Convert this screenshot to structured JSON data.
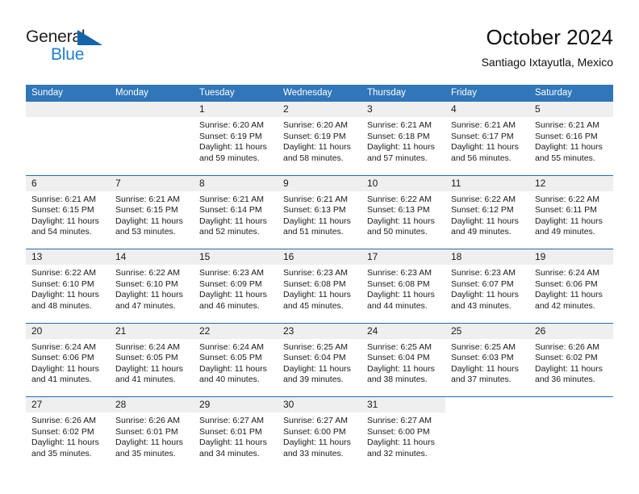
{
  "brand": {
    "name_top": "General",
    "name_bottom": "Blue",
    "color_dark": "#231f20",
    "color_blue": "#1f7fd0",
    "triangle_color": "#1464aa"
  },
  "header": {
    "title": "October 2024",
    "subtitle": "Santiago Ixtayutla, Mexico"
  },
  "theme": {
    "header_bg": "#3076b8",
    "week_rule": "#1f6db5",
    "day_strip_bg": "#efefef"
  },
  "weekdays": [
    "Sunday",
    "Monday",
    "Tuesday",
    "Wednesday",
    "Thursday",
    "Friday",
    "Saturday"
  ],
  "weeks": [
    [
      {
        "day": "",
        "empty": true,
        "sunrise": "",
        "sunset": "",
        "daylight_line1": "",
        "daylight_line2": ""
      },
      {
        "day": "",
        "empty": true,
        "sunrise": "",
        "sunset": "",
        "daylight_line1": "",
        "daylight_line2": ""
      },
      {
        "day": "1",
        "sunrise": "Sunrise: 6:20 AM",
        "sunset": "Sunset: 6:19 PM",
        "daylight_line1": "Daylight: 11 hours",
        "daylight_line2": "and 59 minutes."
      },
      {
        "day": "2",
        "sunrise": "Sunrise: 6:20 AM",
        "sunset": "Sunset: 6:19 PM",
        "daylight_line1": "Daylight: 11 hours",
        "daylight_line2": "and 58 minutes."
      },
      {
        "day": "3",
        "sunrise": "Sunrise: 6:21 AM",
        "sunset": "Sunset: 6:18 PM",
        "daylight_line1": "Daylight: 11 hours",
        "daylight_line2": "and 57 minutes."
      },
      {
        "day": "4",
        "sunrise": "Sunrise: 6:21 AM",
        "sunset": "Sunset: 6:17 PM",
        "daylight_line1": "Daylight: 11 hours",
        "daylight_line2": "and 56 minutes."
      },
      {
        "day": "5",
        "sunrise": "Sunrise: 6:21 AM",
        "sunset": "Sunset: 6:16 PM",
        "daylight_line1": "Daylight: 11 hours",
        "daylight_line2": "and 55 minutes."
      }
    ],
    [
      {
        "day": "6",
        "sunrise": "Sunrise: 6:21 AM",
        "sunset": "Sunset: 6:15 PM",
        "daylight_line1": "Daylight: 11 hours",
        "daylight_line2": "and 54 minutes."
      },
      {
        "day": "7",
        "sunrise": "Sunrise: 6:21 AM",
        "sunset": "Sunset: 6:15 PM",
        "daylight_line1": "Daylight: 11 hours",
        "daylight_line2": "and 53 minutes."
      },
      {
        "day": "8",
        "sunrise": "Sunrise: 6:21 AM",
        "sunset": "Sunset: 6:14 PM",
        "daylight_line1": "Daylight: 11 hours",
        "daylight_line2": "and 52 minutes."
      },
      {
        "day": "9",
        "sunrise": "Sunrise: 6:21 AM",
        "sunset": "Sunset: 6:13 PM",
        "daylight_line1": "Daylight: 11 hours",
        "daylight_line2": "and 51 minutes."
      },
      {
        "day": "10",
        "sunrise": "Sunrise: 6:22 AM",
        "sunset": "Sunset: 6:13 PM",
        "daylight_line1": "Daylight: 11 hours",
        "daylight_line2": "and 50 minutes."
      },
      {
        "day": "11",
        "sunrise": "Sunrise: 6:22 AM",
        "sunset": "Sunset: 6:12 PM",
        "daylight_line1": "Daylight: 11 hours",
        "daylight_line2": "and 49 minutes."
      },
      {
        "day": "12",
        "sunrise": "Sunrise: 6:22 AM",
        "sunset": "Sunset: 6:11 PM",
        "daylight_line1": "Daylight: 11 hours",
        "daylight_line2": "and 49 minutes."
      }
    ],
    [
      {
        "day": "13",
        "sunrise": "Sunrise: 6:22 AM",
        "sunset": "Sunset: 6:10 PM",
        "daylight_line1": "Daylight: 11 hours",
        "daylight_line2": "and 48 minutes."
      },
      {
        "day": "14",
        "sunrise": "Sunrise: 6:22 AM",
        "sunset": "Sunset: 6:10 PM",
        "daylight_line1": "Daylight: 11 hours",
        "daylight_line2": "and 47 minutes."
      },
      {
        "day": "15",
        "sunrise": "Sunrise: 6:23 AM",
        "sunset": "Sunset: 6:09 PM",
        "daylight_line1": "Daylight: 11 hours",
        "daylight_line2": "and 46 minutes."
      },
      {
        "day": "16",
        "sunrise": "Sunrise: 6:23 AM",
        "sunset": "Sunset: 6:08 PM",
        "daylight_line1": "Daylight: 11 hours",
        "daylight_line2": "and 45 minutes."
      },
      {
        "day": "17",
        "sunrise": "Sunrise: 6:23 AM",
        "sunset": "Sunset: 6:08 PM",
        "daylight_line1": "Daylight: 11 hours",
        "daylight_line2": "and 44 minutes."
      },
      {
        "day": "18",
        "sunrise": "Sunrise: 6:23 AM",
        "sunset": "Sunset: 6:07 PM",
        "daylight_line1": "Daylight: 11 hours",
        "daylight_line2": "and 43 minutes."
      },
      {
        "day": "19",
        "sunrise": "Sunrise: 6:24 AM",
        "sunset": "Sunset: 6:06 PM",
        "daylight_line1": "Daylight: 11 hours",
        "daylight_line2": "and 42 minutes."
      }
    ],
    [
      {
        "day": "20",
        "sunrise": "Sunrise: 6:24 AM",
        "sunset": "Sunset: 6:06 PM",
        "daylight_line1": "Daylight: 11 hours",
        "daylight_line2": "and 41 minutes."
      },
      {
        "day": "21",
        "sunrise": "Sunrise: 6:24 AM",
        "sunset": "Sunset: 6:05 PM",
        "daylight_line1": "Daylight: 11 hours",
        "daylight_line2": "and 41 minutes."
      },
      {
        "day": "22",
        "sunrise": "Sunrise: 6:24 AM",
        "sunset": "Sunset: 6:05 PM",
        "daylight_line1": "Daylight: 11 hours",
        "daylight_line2": "and 40 minutes."
      },
      {
        "day": "23",
        "sunrise": "Sunrise: 6:25 AM",
        "sunset": "Sunset: 6:04 PM",
        "daylight_line1": "Daylight: 11 hours",
        "daylight_line2": "and 39 minutes."
      },
      {
        "day": "24",
        "sunrise": "Sunrise: 6:25 AM",
        "sunset": "Sunset: 6:04 PM",
        "daylight_line1": "Daylight: 11 hours",
        "daylight_line2": "and 38 minutes."
      },
      {
        "day": "25",
        "sunrise": "Sunrise: 6:25 AM",
        "sunset": "Sunset: 6:03 PM",
        "daylight_line1": "Daylight: 11 hours",
        "daylight_line2": "and 37 minutes."
      },
      {
        "day": "26",
        "sunrise": "Sunrise: 6:26 AM",
        "sunset": "Sunset: 6:02 PM",
        "daylight_line1": "Daylight: 11 hours",
        "daylight_line2": "and 36 minutes."
      }
    ],
    [
      {
        "day": "27",
        "sunrise": "Sunrise: 6:26 AM",
        "sunset": "Sunset: 6:02 PM",
        "daylight_line1": "Daylight: 11 hours",
        "daylight_line2": "and 35 minutes."
      },
      {
        "day": "28",
        "sunrise": "Sunrise: 6:26 AM",
        "sunset": "Sunset: 6:01 PM",
        "daylight_line1": "Daylight: 11 hours",
        "daylight_line2": "and 35 minutes."
      },
      {
        "day": "29",
        "sunrise": "Sunrise: 6:27 AM",
        "sunset": "Sunset: 6:01 PM",
        "daylight_line1": "Daylight: 11 hours",
        "daylight_line2": "and 34 minutes."
      },
      {
        "day": "30",
        "sunrise": "Sunrise: 6:27 AM",
        "sunset": "Sunset: 6:00 PM",
        "daylight_line1": "Daylight: 11 hours",
        "daylight_line2": "and 33 minutes."
      },
      {
        "day": "31",
        "sunrise": "Sunrise: 6:27 AM",
        "sunset": "Sunset: 6:00 PM",
        "daylight_line1": "Daylight: 11 hours",
        "daylight_line2": "and 32 minutes."
      },
      {
        "day": "",
        "blank": true,
        "sunrise": "",
        "sunset": "",
        "daylight_line1": "",
        "daylight_line2": ""
      },
      {
        "day": "",
        "blank": true,
        "sunrise": "",
        "sunset": "",
        "daylight_line1": "",
        "daylight_line2": ""
      }
    ]
  ]
}
